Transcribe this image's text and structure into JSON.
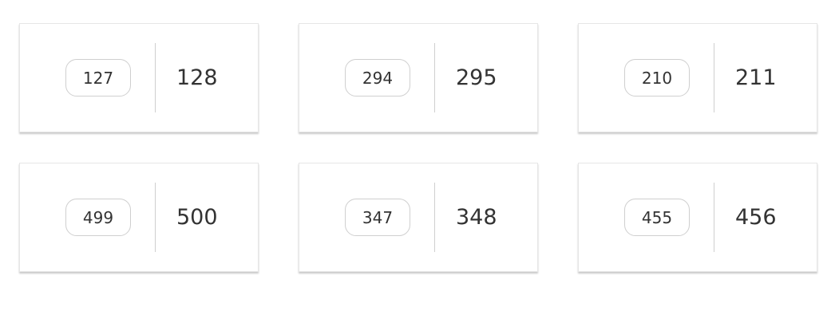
{
  "cards": [
    {
      "button_label": "127",
      "value": "128"
    },
    {
      "button_label": "294",
      "value": "295"
    },
    {
      "button_label": "210",
      "value": "211"
    },
    {
      "button_label": "499",
      "value": "500"
    },
    {
      "button_label": "347",
      "value": "348"
    },
    {
      "button_label": "455",
      "value": "456"
    }
  ]
}
